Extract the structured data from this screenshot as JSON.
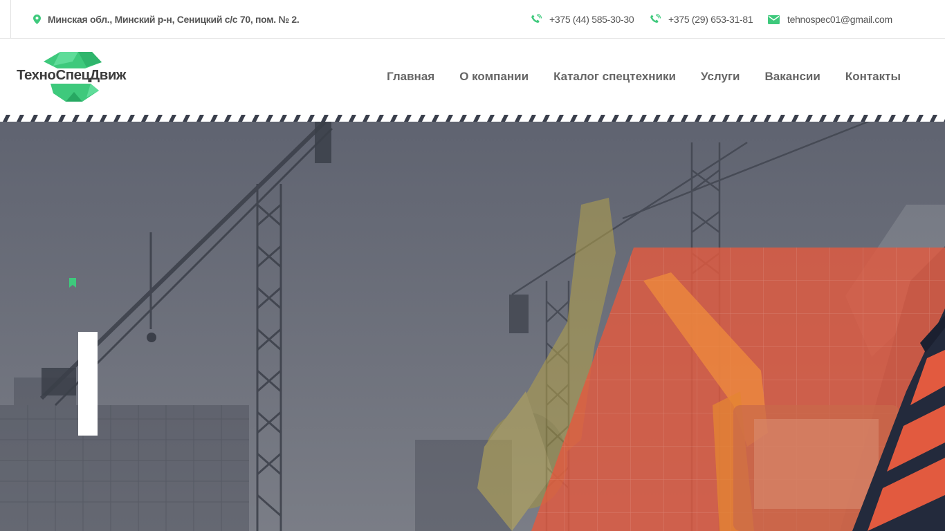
{
  "topbar": {
    "address": "Минская обл., Минский р-н, Сеницкий с/с 70, пом. № 2.",
    "phone1": "+375 (44) 585-30-30",
    "phone2": "+375 (29) 653-31-81",
    "email": "tehnospec01@gmail.com",
    "icons": {
      "address": "map-pin-icon",
      "phone": "phone-icon",
      "email": "envelope-icon"
    }
  },
  "header": {
    "logo_text": "ТехноСпецДвиж",
    "nav": [
      {
        "label": "Главная"
      },
      {
        "label": "О компании"
      },
      {
        "label": "Каталог спецтехники"
      },
      {
        "label": "Услуги"
      },
      {
        "label": "Вакансии"
      },
      {
        "label": "Контакты"
      }
    ]
  },
  "colors": {
    "accent_green": "#3ec97c",
    "text_gray": "#555555",
    "nav_gray": "#666666",
    "hero_overlay": "#5e6270",
    "hero_orange": "#e25a3f",
    "dark_navy": "#232a3c"
  }
}
